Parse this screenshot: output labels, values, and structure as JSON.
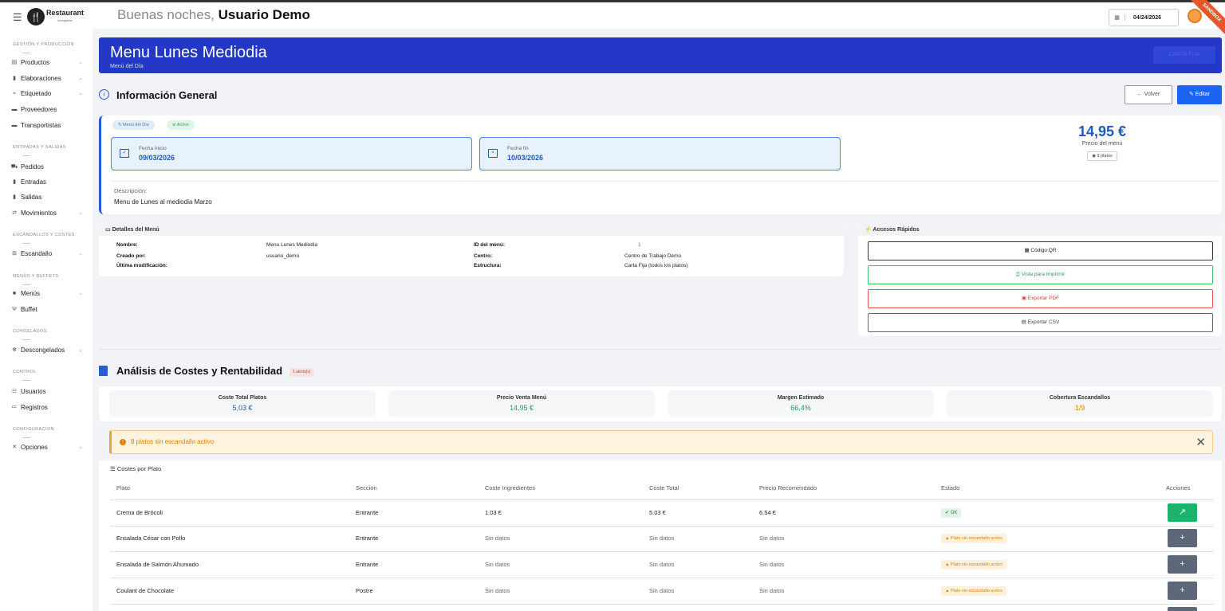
{
  "topbar": {
    "brand": "Restaurant",
    "brand_sub": "inteligente",
    "greeting_prefix": "Buenas noches, ",
    "user_name": "Usuario Demo",
    "date": "04/24/2026",
    "ribbon": "SANDBOX"
  },
  "sidebar": {
    "sections": [
      {
        "title": "GESTIÓN Y PRODUCCIÓN",
        "items": [
          "Productos",
          "Elaboraciones",
          "Etiquetado",
          "Proveedores",
          "Transportistas"
        ]
      },
      {
        "title": "ENTRADAS Y SALIDAS",
        "items": [
          "Pedidos",
          "Entradas",
          "Salidas",
          "Movimientos"
        ]
      },
      {
        "title": "ESCANDALLOS Y COSTES",
        "items": [
          "Escandallo"
        ]
      },
      {
        "title": "MENÚS Y BUFFETS",
        "items": [
          "Menús",
          "Buffet"
        ]
      },
      {
        "title": "CONGELADOS",
        "items": [
          "Descongelados"
        ]
      },
      {
        "title": "CONTROL",
        "items": [
          "Usuarios",
          "Registros"
        ]
      },
      {
        "title": "CONFIGURACIÓN",
        "items": [
          "Opciones"
        ]
      }
    ]
  },
  "header": {
    "title": "Menu Lunes Mediodia",
    "subtitle": "Menú del Día",
    "carta_button": "CARTA FIJA"
  },
  "info": {
    "title": "Información General",
    "back": "Volver",
    "edit": "Editar",
    "badge_type": "Menú del Día",
    "badge_status": "Activo",
    "start_label": "Fecha inicio",
    "start_value": "09/03/2026",
    "end_label": "Fecha fin",
    "end_value": "10/03/2026",
    "price": "14,95 €",
    "price_label": "Precio del menú",
    "plates": "9 platos",
    "desc_label": "Descripción:",
    "desc_value": "Menu de Lunes al mediodia Marzo"
  },
  "details": {
    "title": "Detalles del Menú",
    "nombre_k": "Nombre:",
    "nombre_v": "Menu Lunes Mediodia",
    "creado_k": "Creado por:",
    "creado_v": "usuario_demo",
    "ultima_k": "Última modificación:",
    "id_k": "ID del menú:",
    "id_v": "1",
    "centro_k": "Centro:",
    "centro_v": "Centro de Trabajo Demo",
    "estructura_k": "Estructura:",
    "estructura_v": "Carta Fija (todos los platos)"
  },
  "quick": {
    "title": "Accesos Rápidos",
    "qr": "Código QR",
    "print": "Vista para Imprimir",
    "pdf": "Exportar PDF",
    "csv": "Exportar CSV"
  },
  "analysis": {
    "title": "Análisis de Costes y Rentabilidad",
    "alerts": "1 alerta(s)",
    "metrics": [
      {
        "label": "Coste Total Platos",
        "value": "5,03 €",
        "color": "#1f5bbf"
      },
      {
        "label": "Precio Venta Menú",
        "value": "14,95 €",
        "color": "#1ea05a"
      },
      {
        "label": "Margen Estimado",
        "value": "66,4%",
        "color": "#1ea05a"
      },
      {
        "label": "Cobertura Escandallos",
        "value": "1/9",
        "color": "#d9840a"
      }
    ],
    "warning": "8 platos sin escandallo activo"
  },
  "table": {
    "title": "Costes por Plato",
    "headers": [
      "Plato",
      "Sección",
      "Coste Ingredientes",
      "Coste Total",
      "Precio Recomendado",
      "Estado",
      "Acciones"
    ],
    "rows": [
      {
        "plato": "Crema de Brócoli",
        "seccion": "Entrante",
        "ingr": "1.03 €",
        "total": "5.03 €",
        "rec": "6.54 €",
        "estado": "OK"
      },
      {
        "plato": "Ensalada César con Pollo",
        "seccion": "Entrante",
        "ingr": "Sin datos",
        "total": "Sin datos",
        "rec": "Sin datos",
        "estado": "Plato sin escandallo activo"
      },
      {
        "plato": "Ensalada de Salmón Ahumado",
        "seccion": "Entrante",
        "ingr": "Sin datos",
        "total": "Sin datos",
        "rec": "Sin datos",
        "estado": "Plato sin escandallo activo"
      },
      {
        "plato": "Coulant de Chocolate",
        "seccion": "Postre",
        "ingr": "Sin datos",
        "total": "Sin datos",
        "rec": "Sin datos",
        "estado": "Plato sin escandallo activo"
      }
    ]
  }
}
